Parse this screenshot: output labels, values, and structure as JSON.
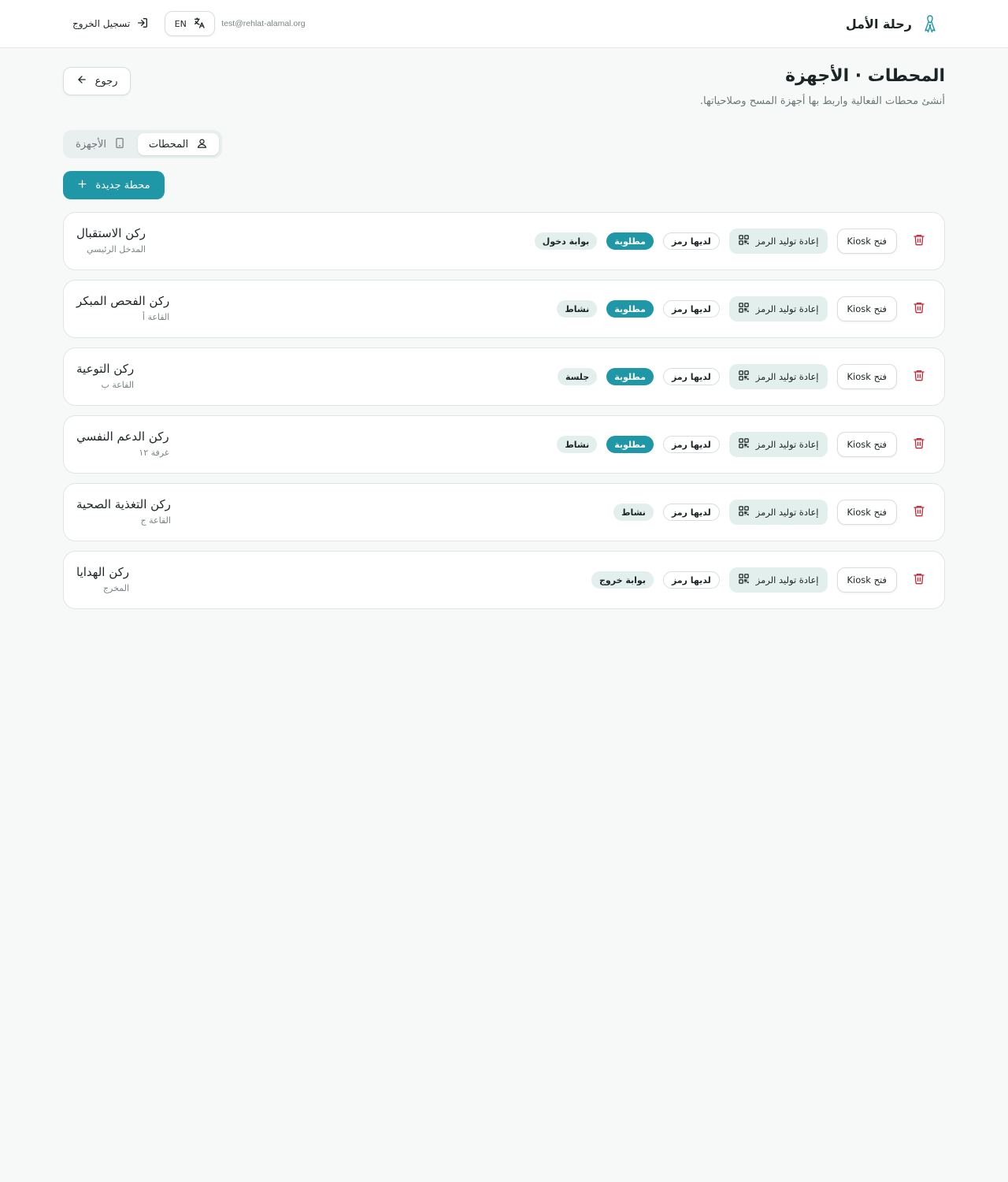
{
  "header": {
    "brand_title": "رحلة الأمل",
    "email": "test@rehlat-alamal.org",
    "lang_label": "EN",
    "logout_label": "تسجيل الخروج"
  },
  "page": {
    "title": "المحطات · الأجهزة",
    "subtitle": "أنشئ محطات الفعالية واربط بها أجهزة المسح وصلاحياتها.",
    "back_label": "رجوع"
  },
  "tabs": [
    {
      "label": "المحطات",
      "active": true
    },
    {
      "label": "الأجهزة",
      "active": false
    }
  ],
  "new_station_label": "محطة جديدة",
  "actions": {
    "kiosk_label": "فتح Kiosk",
    "regen_label": "إعادة توليد الرمز"
  },
  "stations": [
    {
      "name": "ركن الاستقبال",
      "location": "المدخل الرئيسي",
      "badges": [
        "لديها رمز",
        "مطلوبة",
        "بوابة دخول"
      ]
    },
    {
      "name": "ركن الفحص المبكر",
      "location": "القاعة أ",
      "badges": [
        "لديها رمز",
        "مطلوبة",
        "نشاط"
      ]
    },
    {
      "name": "ركن التوعية",
      "location": "القاعة ب",
      "badges": [
        "لديها رمز",
        "مطلوبة",
        "جلسة"
      ]
    },
    {
      "name": "ركن الدعم النفسي",
      "location": "غرفة ١٢",
      "badges": [
        "لديها رمز",
        "مطلوبة",
        "نشاط"
      ]
    },
    {
      "name": "ركن التغذية الصحية",
      "location": "القاعة ج",
      "badges": [
        "لديها رمز",
        "نشاط"
      ]
    },
    {
      "name": "ركن الهدايا",
      "location": "المخرج",
      "badges": [
        "لديها رمز",
        "بوابة خروج"
      ]
    }
  ],
  "colors": {
    "accent": "#1f97a6",
    "danger": "#c62a3a",
    "muted_badge": "#e2efec"
  }
}
